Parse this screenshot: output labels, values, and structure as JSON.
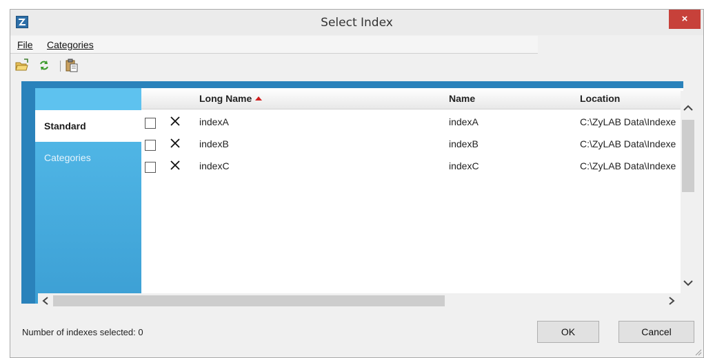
{
  "window": {
    "title": "Select Index",
    "close_label": "×"
  },
  "menu": {
    "items": [
      {
        "label": "File"
      },
      {
        "label": "Categories"
      }
    ]
  },
  "toolbar": {
    "buttons": [
      {
        "icon": "open-folder-icon"
      },
      {
        "icon": "refresh-icon"
      },
      {
        "icon": "paste-icon"
      }
    ]
  },
  "nav": {
    "tabs": [
      {
        "label": "Standard",
        "active": true
      },
      {
        "label": "Categories",
        "active": false
      }
    ]
  },
  "grid": {
    "columns": [
      "Long Name",
      "Name",
      "Location"
    ],
    "sort": {
      "column": "Long Name",
      "direction": "ascending"
    },
    "rows": [
      {
        "checked": false,
        "long_name": "indexA",
        "name": "indexA",
        "location": "C:\\ZyLAB Data\\Indexe"
      },
      {
        "checked": false,
        "long_name": "indexB",
        "name": "indexB",
        "location": "C:\\ZyLAB Data\\Indexe"
      },
      {
        "checked": false,
        "long_name": "indexC",
        "name": "indexC",
        "location": "C:\\ZyLAB Data\\Indexe"
      }
    ]
  },
  "footer": {
    "status": "Number of indexes selected: 0",
    "ok_label": "OK",
    "cancel_label": "Cancel"
  },
  "colors": {
    "accent": "#2a82bb",
    "nav_gradient_top": "#56bdeb",
    "close_button": "#c7413a",
    "sort_arrow": "#d02020"
  }
}
